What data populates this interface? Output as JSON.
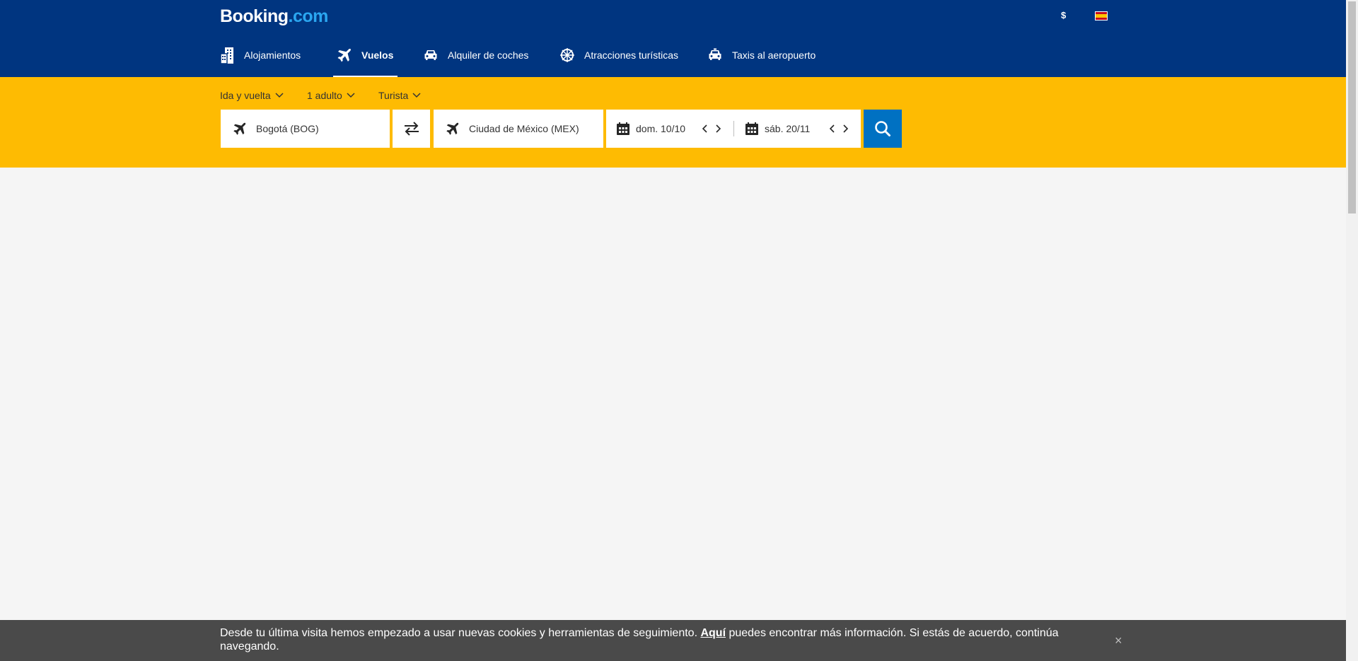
{
  "header": {
    "logo_main": "Booking",
    "logo_dot": ".com",
    "currency": "$",
    "language_flag": "flag-es-icon"
  },
  "nav": {
    "items": [
      {
        "label": "Alojamientos",
        "icon": "building-icon",
        "active": false
      },
      {
        "label": "Vuelos",
        "icon": "plane-icon",
        "active": true
      },
      {
        "label": "Alquiler de coches",
        "icon": "car-icon",
        "active": false
      },
      {
        "label": "Atracciones turísticas",
        "icon": "ferris-wheel-icon",
        "active": false
      },
      {
        "label": "Taxis al aeropuerto",
        "icon": "taxi-icon",
        "active": false
      }
    ]
  },
  "search": {
    "trip_type": "Ida y vuelta",
    "passengers": "1 adulto",
    "cabin_class": "Turista",
    "origin": "Bogotá (BOG)",
    "destination": "Ciudad de México (MEX)",
    "depart_date": "dom. 10/10",
    "return_date": "sáb. 20/11"
  },
  "cookie_banner": {
    "text_before": "Desde tu última visita hemos empezado a usar nuevas cookies y herramientas de seguimiento. ",
    "link": "Aquí",
    "text_after": " puedes encontrar más información. Si estás de acuerdo, continúa navegando.",
    "close": "×"
  },
  "colors": {
    "header_bg": "#003580",
    "search_band": "#febb02",
    "search_button": "#0071c2",
    "cookie_bg": "#4a4a4a"
  }
}
